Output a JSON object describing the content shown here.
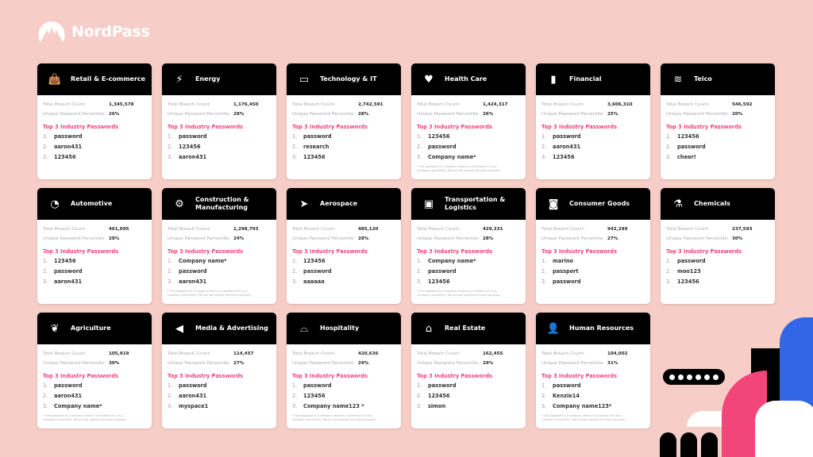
{
  "brand": {
    "name": "NordPass"
  },
  "labels": {
    "breach": "Total Breach Count:",
    "percentile": "Unique Password Percentile:",
    "top3": "Top 3  Industry Passwords",
    "footnote": "* This password is a company name or a variation of it (e.g. Company name2020). We are not naming the exact company."
  },
  "colors": {
    "background": "#f6cec7",
    "accent": "#f0457a",
    "header": "#000000",
    "blue": "#3366e6",
    "pink": "#f2457a"
  },
  "cards": [
    {
      "title": "Retail & E-commerce",
      "icon": "shopping-bag-icon",
      "breach": "1,345,578",
      "percentile": "26%",
      "passwords": [
        "password",
        "aaron431",
        "123456"
      ],
      "note": false
    },
    {
      "title": "Energy",
      "icon": "lightning-icon",
      "breach": "1,176,450",
      "percentile": "28%",
      "passwords": [
        "password",
        "123456",
        "aaron431"
      ],
      "note": false
    },
    {
      "title": "Technology & IT",
      "icon": "monitor-icon",
      "breach": "2,742,591",
      "percentile": "28%",
      "passwords": [
        "password",
        "research",
        "123456"
      ],
      "note": false
    },
    {
      "title": "Health Care",
      "icon": "heart-icon",
      "breach": "1,424,317",
      "percentile": "26%",
      "passwords": [
        "123456",
        "password",
        "Company name*"
      ],
      "note": true
    },
    {
      "title": "Financial",
      "icon": "bar-chart-icon",
      "breach": "3,606,310",
      "percentile": "25%",
      "passwords": [
        "password",
        "aaron431",
        "123456"
      ],
      "note": false
    },
    {
      "title": "Telco",
      "icon": "wifi-icon",
      "breach": "546,592",
      "percentile": "20%",
      "passwords": [
        "123456",
        "password",
        "cheer!"
      ],
      "note": false
    },
    {
      "title": "Automotive",
      "icon": "speedometer-icon",
      "breach": "461,095",
      "percentile": "28%",
      "passwords": [
        "123456",
        "password",
        "aaron431"
      ],
      "note": false
    },
    {
      "title": "Construction & Manufacturing",
      "icon": "gear-icon",
      "breach": "1,298,703",
      "percentile": "24%",
      "passwords": [
        "Company name*",
        "password",
        "aaron431"
      ],
      "note": true
    },
    {
      "title": "Aerospace",
      "icon": "paper-plane-icon",
      "breach": "485,120",
      "percentile": "28%",
      "passwords": [
        "123456",
        "password",
        "aaaaaa"
      ],
      "note": false
    },
    {
      "title": "Transportation & Logistics",
      "icon": "train-icon",
      "breach": "429,331",
      "percentile": "28%",
      "passwords": [
        "Company name*",
        "password",
        "123456"
      ],
      "note": true
    },
    {
      "title": "Consumer Goods",
      "icon": "gamepad-icon",
      "breach": "942,289",
      "percentile": "27%",
      "passwords": [
        "marino",
        "passport",
        "password"
      ],
      "note": false
    },
    {
      "title": "Chemicals",
      "icon": "flask-icon",
      "breach": "237,593",
      "percentile": "30%",
      "passwords": [
        "password",
        "moo123",
        "123456"
      ],
      "note": false
    },
    {
      "title": "Agriculture",
      "icon": "leaf-icon",
      "breach": "105,919",
      "percentile": "30%",
      "passwords": [
        "password",
        "aaron431",
        "Company name*"
      ],
      "note": true
    },
    {
      "title": "Media & Advertising",
      "icon": "megaphone-icon",
      "breach": "114,457",
      "percentile": "27%",
      "passwords": [
        "password",
        "aaron431",
        "myspace1"
      ],
      "note": false
    },
    {
      "title": "Hospitality",
      "icon": "cloche-icon",
      "breach": "420,636",
      "percentile": "29%",
      "passwords": [
        "password",
        "123456",
        "Company name123 *"
      ],
      "note": true
    },
    {
      "title": "Real Estate",
      "icon": "house-icon",
      "breach": "162,455",
      "percentile": "29%",
      "passwords": [
        "password",
        "123456",
        "simon"
      ],
      "note": false
    },
    {
      "title": "Human Resources",
      "icon": "person-icon",
      "breach": "104,002",
      "percentile": "31%",
      "passwords": [
        "password",
        "Kenzie14",
        "Company name123*"
      ],
      "note": true
    }
  ]
}
